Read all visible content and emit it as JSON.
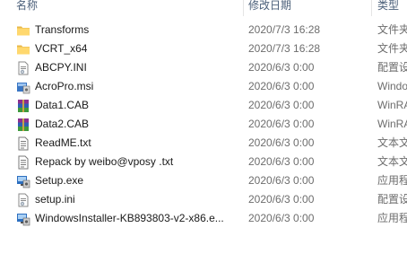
{
  "columns": {
    "name": "名称",
    "date": "修改日期",
    "type": "类型"
  },
  "files": [
    {
      "name": "Transforms",
      "date": "2020/7/3 16:28",
      "type": "文件夹",
      "icon": "folder-icon"
    },
    {
      "name": "VCRT_x64",
      "date": "2020/7/3 16:28",
      "type": "文件夹",
      "icon": "folder-icon"
    },
    {
      "name": "ABCPY.INI",
      "date": "2020/6/3 0:00",
      "type": "配置设置",
      "icon": "config-file-icon"
    },
    {
      "name": "AcroPro.msi",
      "date": "2020/6/3 0:00",
      "type": "Windows Installer",
      "icon": "installer-icon"
    },
    {
      "name": "Data1.CAB",
      "date": "2020/6/3 0:00",
      "type": "WinRAR",
      "icon": "winrar-icon"
    },
    {
      "name": "Data2.CAB",
      "date": "2020/6/3 0:00",
      "type": "WinRAR",
      "icon": "winrar-icon"
    },
    {
      "name": "ReadME.txt",
      "date": "2020/6/3 0:00",
      "type": "文本文档",
      "icon": "text-file-icon"
    },
    {
      "name": "Repack by weibo@vposy .txt",
      "date": "2020/6/3 0:00",
      "type": "文本文档",
      "icon": "text-file-icon"
    },
    {
      "name": "Setup.exe",
      "date": "2020/6/3 0:00",
      "type": "应用程序",
      "icon": "setup-exe-icon"
    },
    {
      "name": "setup.ini",
      "date": "2020/6/3 0:00",
      "type": "配置设置",
      "icon": "config-file-icon"
    },
    {
      "name": "WindowsInstaller-KB893803-v2-x86.e...",
      "date": "2020/6/3 0:00",
      "type": "应用程序",
      "icon": "setup-exe-icon"
    }
  ]
}
